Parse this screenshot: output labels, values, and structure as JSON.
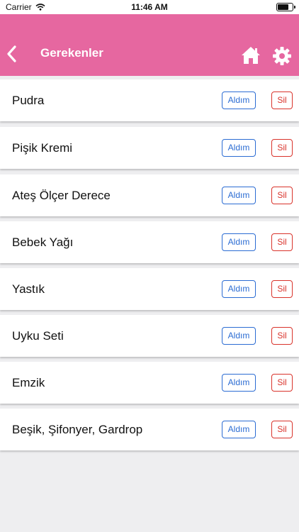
{
  "status_bar": {
    "carrier": "Carrier",
    "time": "11:46 AM"
  },
  "navbar": {
    "title": "Gerekenler",
    "icons": [
      "chevron-left-icon",
      "home-icon",
      "gear-icon"
    ],
    "color": "#e667a0"
  },
  "items": [
    {
      "label": "Pudra",
      "bought_label": "Aldım",
      "delete_label": "Sil"
    },
    {
      "label": "Pişik Kremi",
      "bought_label": "Aldım",
      "delete_label": "Sil"
    },
    {
      "label": "Ateş Ölçer Derece",
      "bought_label": "Aldım",
      "delete_label": "Sil"
    },
    {
      "label": "Bebek Yağı",
      "bought_label": "Aldım",
      "delete_label": "Sil"
    },
    {
      "label": "Yastık",
      "bought_label": "Aldım",
      "delete_label": "Sil"
    },
    {
      "label": "Uyku Seti",
      "bought_label": "Aldım",
      "delete_label": "Sil"
    },
    {
      "label": "Emzik",
      "bought_label": "Aldım",
      "delete_label": "Sil"
    },
    {
      "label": "Beşik, Şifonyer, Gardrop",
      "bought_label": "Aldım",
      "delete_label": "Sil"
    }
  ],
  "colors": {
    "bought": "#2b6cd3",
    "delete": "#d9332b",
    "background": "#eeeef0"
  }
}
